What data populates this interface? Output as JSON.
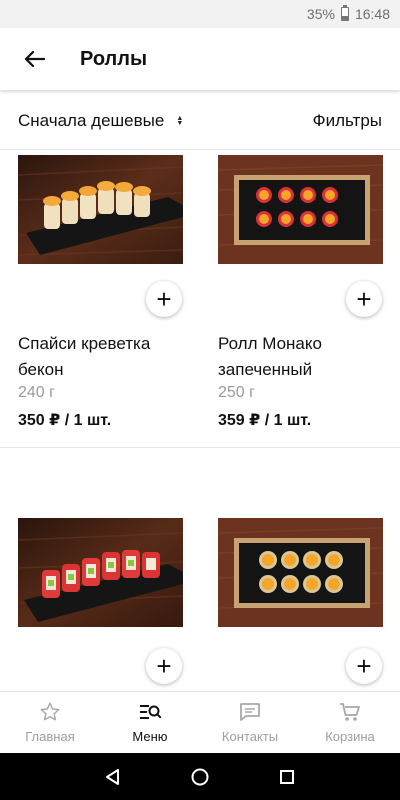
{
  "status_bar": {
    "battery": "35%",
    "time": "16:48",
    "battery_level": 0.35
  },
  "header": {
    "title": "Роллы",
    "back_icon": "arrow-left-icon"
  },
  "sort": {
    "label": "Сначала дешевые",
    "filters": "Фильтры"
  },
  "products": [
    {
      "name": "Спайси креветка бекон",
      "weight": "240 г",
      "price": "350 ₽ / 1 шт.",
      "add": "+"
    },
    {
      "name": "Ролл Монако запеченный",
      "weight": "250 г",
      "price": "359 ₽ / 1 шт.",
      "add": "+"
    },
    {
      "add": "+"
    },
    {
      "add": "+"
    }
  ],
  "bottom_nav": [
    {
      "label": "Главная",
      "icon": "star-icon"
    },
    {
      "label": "Меню",
      "icon": "menu-search-icon",
      "active": true
    },
    {
      "label": "Контакты",
      "icon": "chat-icon"
    },
    {
      "label": "Корзина",
      "icon": "cart-icon"
    }
  ],
  "colors": {
    "text": "#111111",
    "muted": "#9a9a9a",
    "wood": "#5a2a18",
    "nav_bar": "#000000"
  }
}
